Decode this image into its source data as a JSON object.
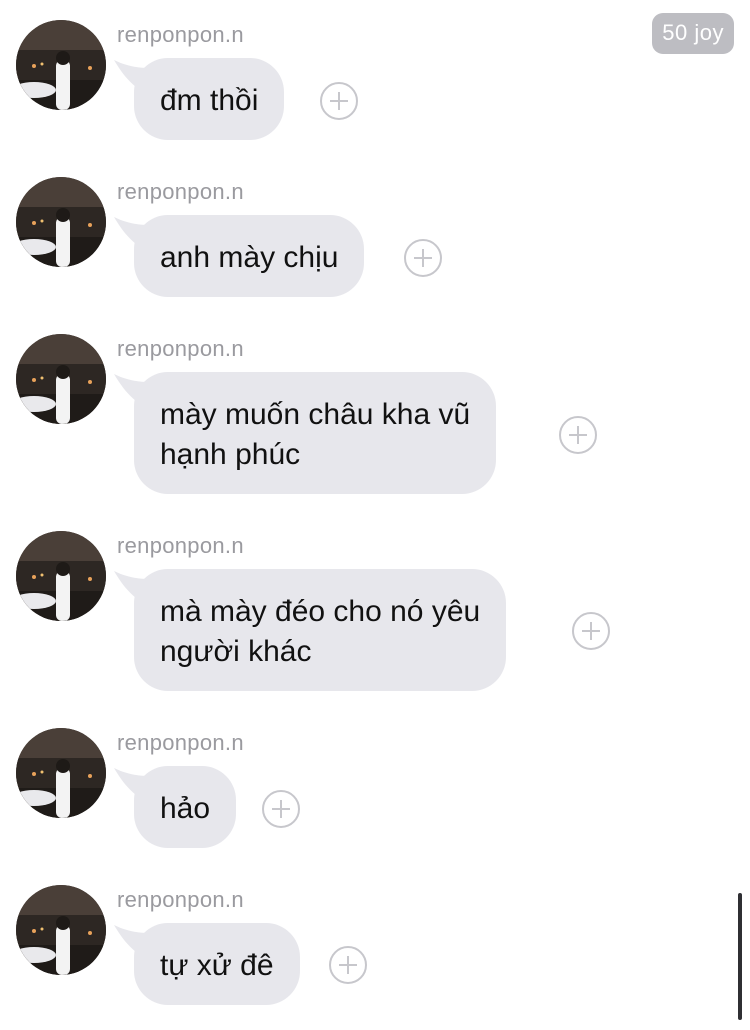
{
  "badge": {
    "label": "50 joy"
  },
  "messages": [
    {
      "sender": "renponpon.n",
      "text": "đm thồi",
      "avatar": "profile-avatar"
    },
    {
      "sender": "renponpon.n",
      "text": "anh mày chịu",
      "avatar": "profile-avatar"
    },
    {
      "sender": "renponpon.n",
      "text": "mày muốn châu kha vũ\nhạnh phúc",
      "avatar": "profile-avatar"
    },
    {
      "sender": "renponpon.n",
      "text": "mà mày đéo cho nó yêu\nngười khác",
      "avatar": "profile-avatar"
    },
    {
      "sender": "renponpon.n",
      "text": "hảo",
      "avatar": "profile-avatar"
    },
    {
      "sender": "renponpon.n",
      "text": "tự xử đê",
      "avatar": "profile-avatar"
    }
  ],
  "icons": {
    "add_reaction": "plus-circle-icon"
  },
  "colors": {
    "bubble": "#e7e7ec",
    "sender": "#9a9a9f",
    "plus": "#c7c7cc",
    "badge": "#bdbdc2"
  }
}
